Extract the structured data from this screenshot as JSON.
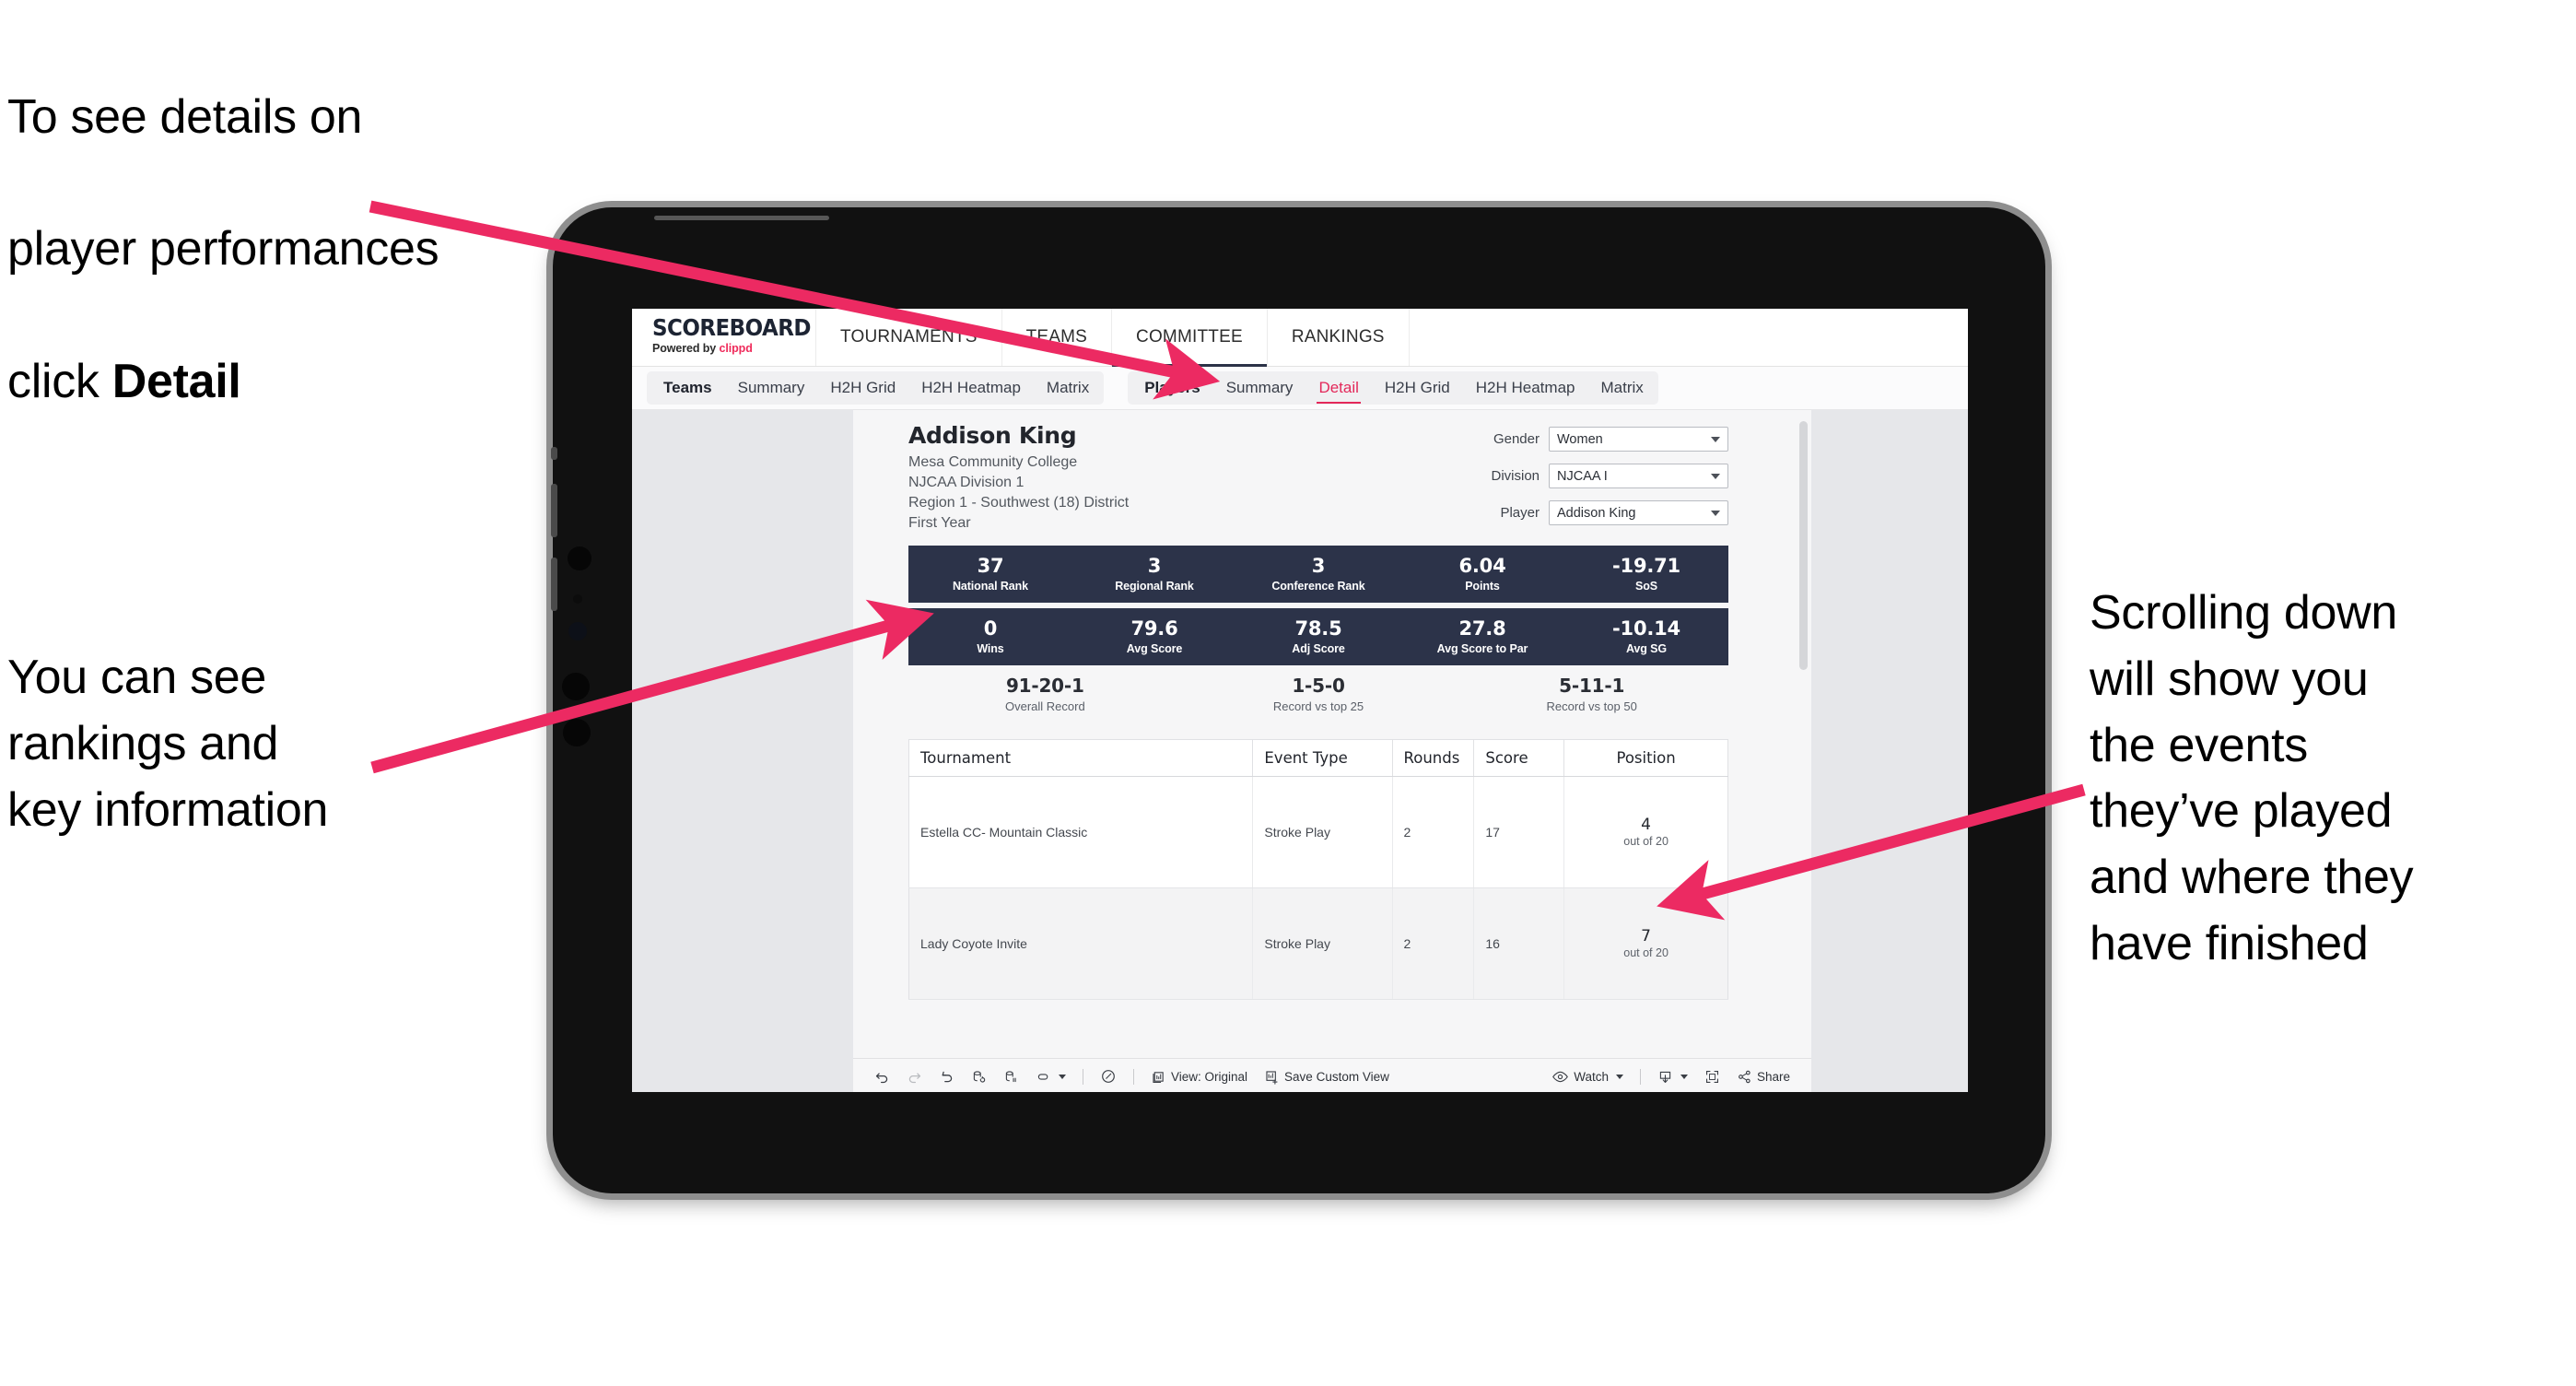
{
  "annotations": {
    "top_left_line1": "To see details on",
    "top_left_line2": "player performances",
    "top_left_line3_prefix": "click ",
    "top_left_line3_bold": "Detail",
    "mid_left": "You can see\nrankings and\nkey information",
    "right": "Scrolling down\nwill show you\nthe events\nthey’ve played\nand where they\nhave finished",
    "arrow_color": "#ec2a62"
  },
  "app": {
    "brand": {
      "logo_text": "SCOREBOARD",
      "powered_prefix": "Powered by ",
      "powered_brand": "clippd",
      "brand_color": "#ef2b5b"
    },
    "top_nav": [
      {
        "label": "TOURNAMENTS",
        "active": false
      },
      {
        "label": "TEAMS",
        "active": false
      },
      {
        "label": "COMMITTEE",
        "active": true
      },
      {
        "label": "RANKINGS",
        "active": false
      }
    ],
    "sub_nav": {
      "group_teams": {
        "lead": "Teams",
        "tabs": [
          {
            "label": "Summary",
            "active": false
          },
          {
            "label": "H2H Grid",
            "active": false
          },
          {
            "label": "H2H Heatmap",
            "active": false
          },
          {
            "label": "Matrix",
            "active": false
          }
        ]
      },
      "group_players": {
        "lead": "Players",
        "tabs": [
          {
            "label": "Summary",
            "active": false
          },
          {
            "label": "Detail",
            "active": true
          },
          {
            "label": "H2H Grid",
            "active": false
          },
          {
            "label": "H2H Heatmap",
            "active": false
          },
          {
            "label": "Matrix",
            "active": false
          }
        ]
      }
    }
  },
  "player": {
    "name": "Addison King",
    "school": "Mesa Community College",
    "division": "NJCAA Division 1",
    "region": "Region 1 - Southwest (18) District",
    "class_year": "First Year"
  },
  "filters": [
    {
      "label": "Gender",
      "value": "Women"
    },
    {
      "label": "Division",
      "value": "NJCAA I"
    },
    {
      "label": "Player",
      "value": "Addison King"
    }
  ],
  "stats_band_1": [
    {
      "value": "37",
      "label": "National Rank"
    },
    {
      "value": "3",
      "label": "Regional Rank"
    },
    {
      "value": "3",
      "label": "Conference Rank"
    },
    {
      "value": "6.04",
      "label": "Points"
    },
    {
      "value": "-19.71",
      "label": "SoS"
    }
  ],
  "stats_band_2": [
    {
      "value": "0",
      "label": "Wins"
    },
    {
      "value": "79.6",
      "label": "Avg Score"
    },
    {
      "value": "78.5",
      "label": "Adj Score"
    },
    {
      "value": "27.8",
      "label": "Avg Score to Par"
    },
    {
      "value": "-10.14",
      "label": "Avg SG"
    }
  ],
  "records": [
    {
      "value": "91-20-1",
      "label": "Overall Record"
    },
    {
      "value": "1-5-0",
      "label": "Record vs top 25"
    },
    {
      "value": "5-11-1",
      "label": "Record vs top 50"
    }
  ],
  "events_table": {
    "headers": [
      "Tournament",
      "Event Type",
      "Rounds",
      "Score",
      "Position"
    ],
    "rows": [
      {
        "tournament": "Estella CC- Mountain Classic",
        "event_type": "Stroke Play",
        "rounds": "2",
        "score": "17",
        "position": "4",
        "position_of": "out of 20"
      },
      {
        "tournament": "Lady Coyote Invite",
        "event_type": "Stroke Play",
        "rounds": "2",
        "score": "16",
        "position": "7",
        "position_of": "out of 20"
      }
    ]
  },
  "bottom_toolbar": {
    "undo": "undo-icon",
    "redo": "redo-icon",
    "revert": "revert-icon",
    "refresh": "refresh-data-icon",
    "pause": "pause-updates-icon",
    "more": "more-icon",
    "clock": "clock-icon",
    "view_label": "View: Original",
    "save_label": "Save Custom View",
    "watch_label": "Watch",
    "download": "download-icon",
    "fullscreen": "fullscreen-icon",
    "share_label": "Share"
  }
}
